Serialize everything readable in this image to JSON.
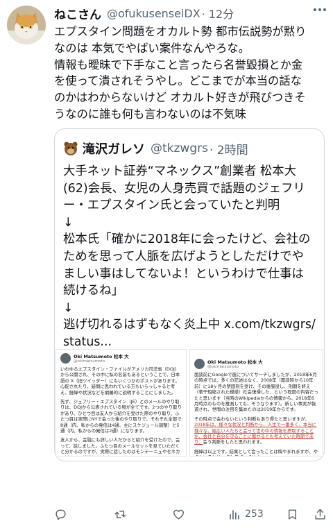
{
  "author": {
    "display_name": "ねこさん",
    "handle": "@ofukusenseiDX",
    "time": "· 12分"
  },
  "tweet_lines": [
    "エプスタイン問題をオカルト勢 都市伝説勢が黙り",
    "なのは 本気でやばい案件なんやろな。",
    "情報も曖昧で下手なこと言ったら名誉毀損とか金",
    "を使って潰されそうやし。どこまでが本当の話な",
    "のかはわからないけど オカルト好きが飛びつきそ",
    "うなのに誰も何も言わないのは不気味"
  ],
  "quote": {
    "display_name": "滝沢ガレソ",
    "handle": "@tkzwgrs",
    "time": "· 2時間",
    "lines": [
      "大手ネット証券“マネックス”創業者 松本大",
      "(62)会長、女児の人身売買で話題のジェフリ",
      "ー・エプスタイン氏と会っていたと判明",
      "↓",
      "松本氏「確かに2018年に会ったけど、会社の",
      "ためを思って人脈を広げようとしただけでや",
      "ましい事はしてないよ！というわけで仕事は",
      "続けるね」",
      "↓",
      "逃げ切れるはずもなく炎上中 x.com/tkzwgrs/",
      "status..."
    ],
    "screenshots": [
      {
        "name": "Oki Matsumoto 松本 大",
        "handle": "@okimatsumoto",
        "paragraphs": [
          "いわゆるエプスタイン・ファイルがアメリカ司法省（DOJ）から公開され、その中に私の名前もあるということで、日本語の X（旧ツイッター）にもいくつかのポストがあります。心配されたり、疑問に思われている方もいらっしゃると考え、経緯や状況などを網羅的に説明することにしました。",
          "先ず、ジェフリー・エプスタイン（JE）とのメールのやり取りは、DOJから公表されている物が全てです。2つのやり取りがあり、ひとつ目は友人から紹介を受けた際のやり取り、ふたつ目は実際にNYで会った後のやり取りで、それぞれ全部で8通（内、私からの発信は4通、主にスケジュール調整）と5通（内、私からの発信は2通）になります。",
          "友人から、金融にも詳しい人だからと紹介を受けたので、会って、話しました。ふたつ目のメールセットを見ていただくと分かるのですが、実際に話したのはモンテーニュやセネカの話など、哲学的な話がほとんどでし"
        ]
      },
      {
        "name": "Oki Matsumoto 松本 大",
        "handle": "@okimatsumoto",
        "paragraphs": [
          "面談前にGoogleで彼についてサーチしましたが、2018年6月の時点では、多くの記述はなく、2008年（面談時から10年前）に18ヶ月の禁固刑を受け、その後服役し、刑期を終え（若干短縮された模様）社会復帰した、という程度の内容だったと思います（当時のWikipediaからの情報から、2018年6月時点のものを推測しても、そうなります）。新しい事実が報道され、世間の注目を集めたのは2019年からです。",
          "その時点で会わないという判断もあり得たと思いますが、",
          "2018年は、様々な状況と判断から、人生で一番多く、本当に様々な、幅広い人たちと会って世の中の情報を摂取することが、会社と自分を守ることに繋がるとも考えていた時期であり、",
          "会う判断をしたと思われます。",
          "経緯は以上です。結果として会ったことは悔やまれますが、やましいことは一点もございません。"
        ]
      }
    ]
  },
  "actions": {
    "views": "253"
  },
  "colors": {
    "text": "#0f1419",
    "secondary": "#536471",
    "border": "#cfd9de"
  }
}
